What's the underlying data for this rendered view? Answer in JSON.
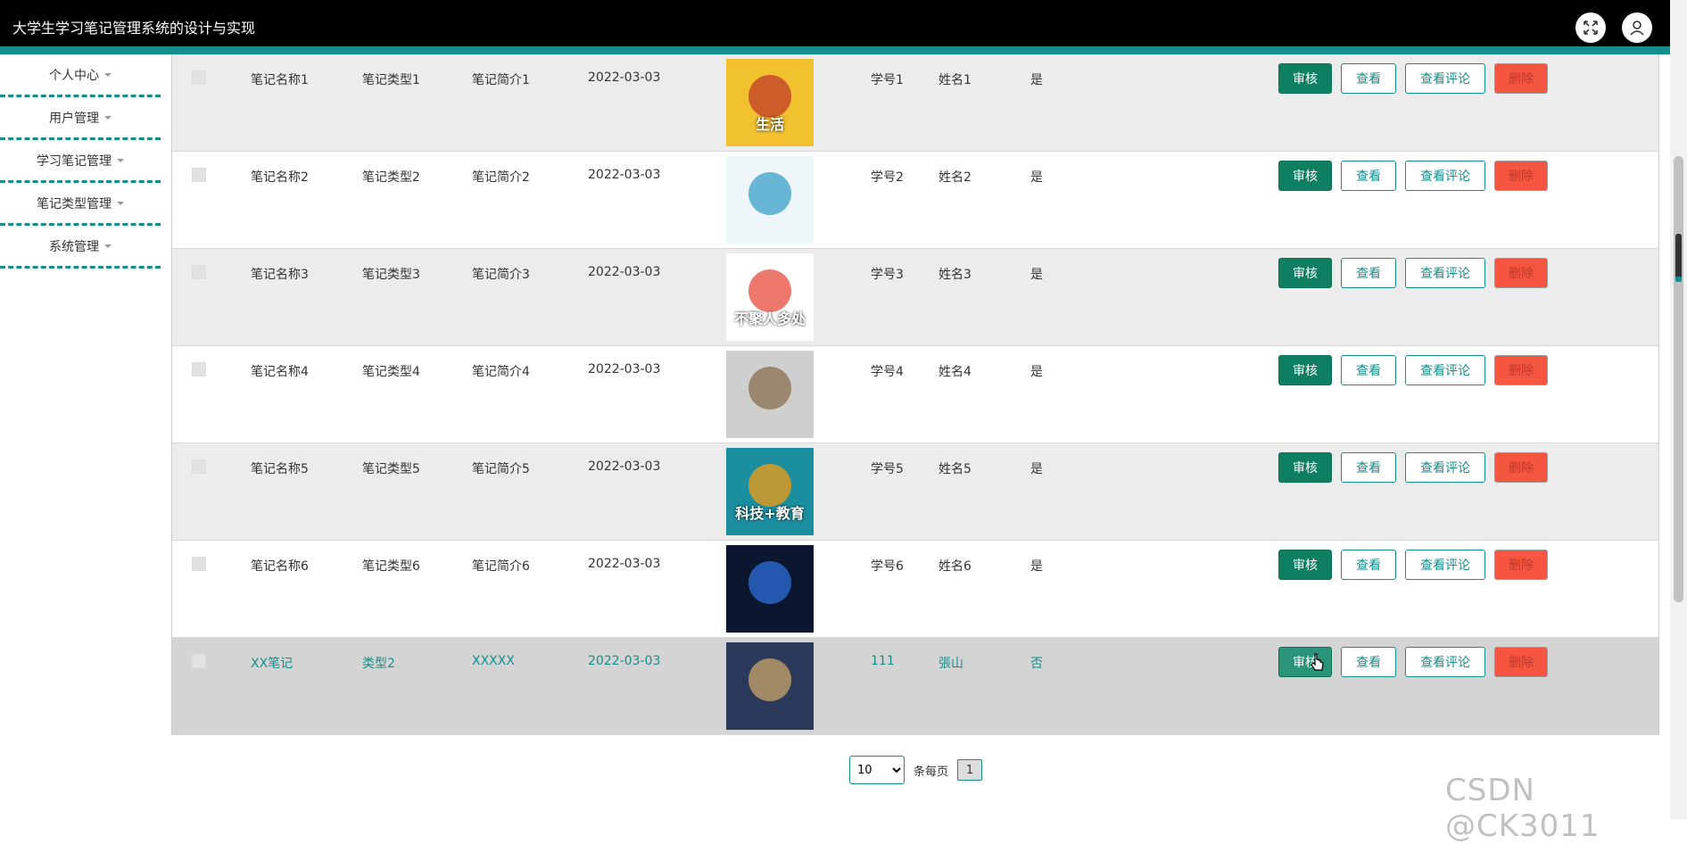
{
  "header": {
    "title": "大学生学习笔记管理系统的设计与实现"
  },
  "sidebar": {
    "items": [
      {
        "label": "个人中心"
      },
      {
        "label": "用户管理"
      },
      {
        "label": "学习笔记管理"
      },
      {
        "label": "笔记类型管理"
      },
      {
        "label": "系统管理"
      }
    ]
  },
  "actions": {
    "audit": "审核",
    "view": "查看",
    "comments": "查看评论",
    "delete": "删除"
  },
  "rows": [
    {
      "name": "笔记名称1",
      "type": "笔记类型1",
      "intro": "笔记简介1",
      "date": "2022-03-03",
      "student_no": "学号1",
      "student_name": "姓名1",
      "flag": "是"
    },
    {
      "name": "笔记名称2",
      "type": "笔记类型2",
      "intro": "笔记简介2",
      "date": "2022-03-03",
      "student_no": "学号2",
      "student_name": "姓名2",
      "flag": "是"
    },
    {
      "name": "笔记名称3",
      "type": "笔记类型3",
      "intro": "笔记简介3",
      "date": "2022-03-03",
      "student_no": "学号3",
      "student_name": "姓名3",
      "flag": "是"
    },
    {
      "name": "笔记名称4",
      "type": "笔记类型4",
      "intro": "笔记简介4",
      "date": "2022-03-03",
      "student_no": "学号4",
      "student_name": "姓名4",
      "flag": "是"
    },
    {
      "name": "笔记名称5",
      "type": "笔记类型5",
      "intro": "笔记简介5",
      "date": "2022-03-03",
      "student_no": "学号5",
      "student_name": "姓名5",
      "flag": "是"
    },
    {
      "name": "笔记名称6",
      "type": "笔记类型6",
      "intro": "笔记简介6",
      "date": "2022-03-03",
      "student_no": "学号6",
      "student_name": "姓名6",
      "flag": "是"
    },
    {
      "name": "XX笔记",
      "type": "类型2",
      "intro": "XXXXX",
      "date": "2022-03-03",
      "student_no": "111",
      "student_name": "張山",
      "flag": "否"
    }
  ],
  "thumbs": [
    {
      "caption": "生活",
      "colors": [
        "#f2c12e",
        "#c0392b"
      ]
    },
    {
      "caption": "",
      "colors": [
        "#eef6fa",
        "#3aa0c8"
      ]
    },
    {
      "caption": "不聚人多处",
      "colors": [
        "#ffffff",
        "#e74c3c"
      ]
    },
    {
      "caption": "",
      "colors": [
        "#cfcfcf",
        "#8a6d4e"
      ]
    },
    {
      "caption": "科技+教育",
      "colors": [
        "#1b8fa0",
        "#f39c12"
      ]
    },
    {
      "caption": "",
      "colors": [
        "#0b1630",
        "#2e6fd8"
      ]
    },
    {
      "caption": "",
      "colors": [
        "#2b3a5a",
        "#c9a46a"
      ]
    }
  ],
  "pager": {
    "page_size": "10",
    "per_page_label": "条每页",
    "current_page": "1"
  },
  "watermark": "CSDN @CK3011"
}
